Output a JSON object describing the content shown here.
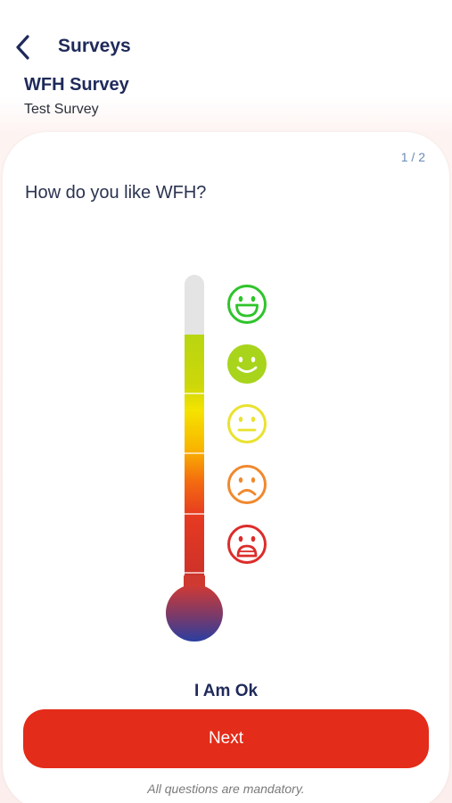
{
  "nav": {
    "title": "Surveys",
    "back_icon": "chevron-left-icon"
  },
  "survey": {
    "title": "WFH Survey",
    "subtitle": "Test Survey"
  },
  "progress": {
    "label": "1 / 2",
    "current": 1,
    "total": 2
  },
  "question": {
    "text": "How do you like WFH?"
  },
  "scale": {
    "levels": [
      {
        "icon": "laughing-face-icon",
        "color": "#2ec42a"
      },
      {
        "icon": "smiling-face-icon",
        "color": "#a8d41c"
      },
      {
        "icon": "neutral-face-icon",
        "color": "#e9e22f"
      },
      {
        "icon": "frowning-face-icon",
        "color": "#f0892e"
      },
      {
        "icon": "sad-face-icon",
        "color": "#dc2c2a"
      }
    ],
    "selected_level": 2
  },
  "answer": {
    "label": "I Am Ok"
  },
  "actions": {
    "next_label": "Next",
    "next_color": "#e32c19"
  },
  "footer": {
    "note": "All questions are mandatory."
  }
}
